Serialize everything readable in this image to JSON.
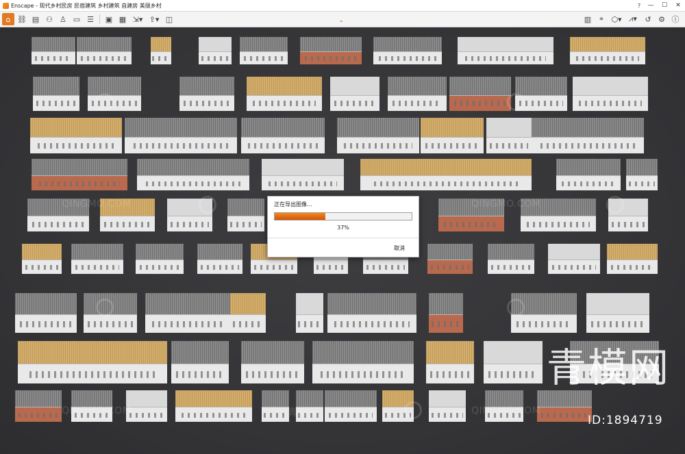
{
  "window": {
    "app_name": "Enscape",
    "title": "Enscape - 现代乡村民房 民宿建筑 乡村建筑 自建房 美丽乡村",
    "buttons": {
      "help": "?",
      "minimize": "—",
      "maximize": "☐",
      "close": "✕"
    }
  },
  "toolbar": {
    "left_icons": [
      "home-icon",
      "link-icon",
      "bim-icon",
      "binoculars-icon",
      "asset-library-icon",
      "video-editor-icon",
      "atmosphere-icon",
      "screenshot-icon",
      "batch-render-icon",
      "export-icon",
      "upload-icon",
      "panorama-icon"
    ],
    "right_icons": [
      "views-icon",
      "capture-icon",
      "cube-icon",
      "map-icon",
      "reset-icon",
      "settings-icon",
      "info-icon"
    ]
  },
  "dialog": {
    "title": "正在导出图像...",
    "progress_value": 0.37,
    "percent_text": "37%",
    "cancel_label": "取消"
  },
  "colors": {
    "accent": "#e07a20",
    "progress_fill": "#e06a10",
    "viewport_bg": "#3a3a3c"
  },
  "watermarks": {
    "brand": "QINGMO.COM",
    "logo_text": "青模网",
    "id_text": "ID:1894719"
  }
}
